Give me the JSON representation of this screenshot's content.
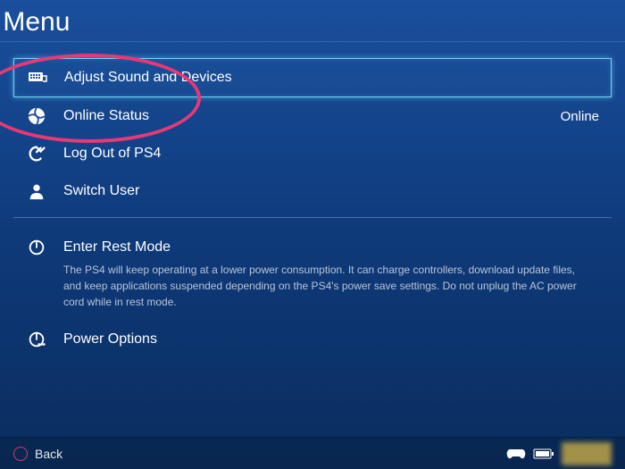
{
  "header": {
    "title": "k Menu"
  },
  "menu": {
    "items": [
      {
        "label": "Adjust Sound and Devices",
        "selected": true
      },
      {
        "label": "Online Status",
        "value": "Online"
      },
      {
        "label": "Log Out of PS4"
      },
      {
        "label": "Switch User"
      }
    ],
    "power": [
      {
        "label": "Enter Rest Mode",
        "description": "The PS4 will keep operating at a lower power consumption. It can charge controllers, download update files, and keep applications suspended depending on the PS4's power save settings. Do not unplug the AC power cord while in rest mode."
      },
      {
        "label": "Power Options"
      }
    ]
  },
  "footer": {
    "back_label": "Back"
  },
  "annotation": {
    "highlight": "adjust-sound-and-devices"
  }
}
